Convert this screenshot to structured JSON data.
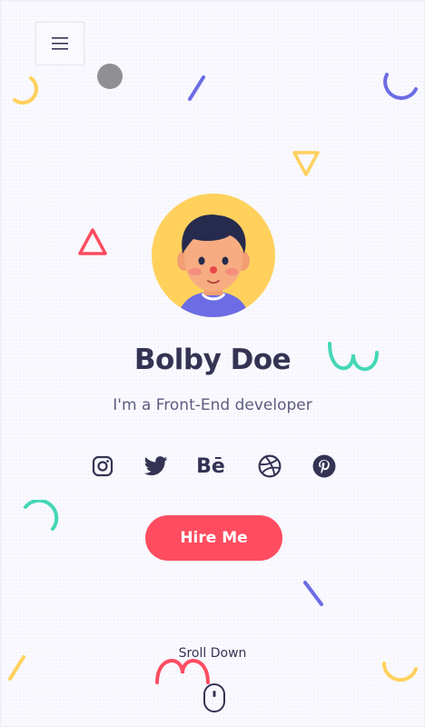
{
  "header": {
    "menu_icon": "hamburger-icon"
  },
  "profile": {
    "name": "Bolby Doe",
    "tagline": "I'm a Front-End developer",
    "avatar_icon": "avatar-illustration"
  },
  "socials": [
    {
      "icon": "instagram-icon"
    },
    {
      "icon": "twitter-icon"
    },
    {
      "icon": "behance-icon",
      "label": "Bē"
    },
    {
      "icon": "dribbble-icon"
    },
    {
      "icon": "pinterest-icon"
    }
  ],
  "cta": {
    "label": "Hire Me"
  },
  "scroll": {
    "label": "Sroll Down",
    "icon": "mouse-icon"
  },
  "colors": {
    "accent": "#ff4c60",
    "yellow": "#ffd15c",
    "purple": "#6c6ce5",
    "teal": "#44d7b6",
    "text": "#353353"
  }
}
